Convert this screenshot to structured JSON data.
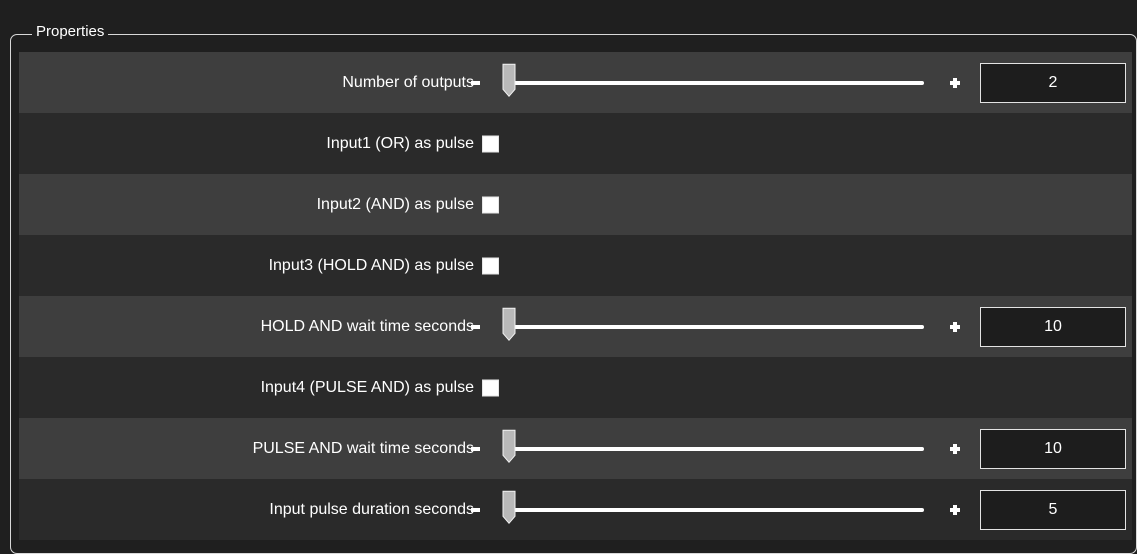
{
  "panel": {
    "title": "Properties"
  },
  "properties": [
    {
      "label": "Number of outputs",
      "type": "slider",
      "value": "2",
      "slider_fraction": 0.0
    },
    {
      "label": "Input1 (OR) as pulse",
      "type": "checkbox",
      "checked": false
    },
    {
      "label": "Input2 (AND) as pulse",
      "type": "checkbox",
      "checked": false
    },
    {
      "label": "Input3 (HOLD AND) as pulse",
      "type": "checkbox",
      "checked": false
    },
    {
      "label": "HOLD AND wait time seconds",
      "type": "slider",
      "value": "10",
      "slider_fraction": 0.0
    },
    {
      "label": "Input4 (PULSE AND) as pulse",
      "type": "checkbox",
      "checked": false
    },
    {
      "label": "PULSE AND wait time seconds",
      "type": "slider",
      "value": "10",
      "slider_fraction": 0.0
    },
    {
      "label": "Input pulse duration seconds",
      "type": "slider",
      "value": "5",
      "slider_fraction": 0.0
    }
  ],
  "colors": {
    "background": "#1f1f1f",
    "row_light": "#3e3e3e",
    "row_dark": "#2a2a2a",
    "text": "#ffffff",
    "thumb_fill": "#b9b9b9"
  },
  "icons": {
    "decrement": "minus-icon",
    "increment": "plus-icon",
    "slider_handle": "slider-thumb-icon",
    "checkbox": "checkbox-icon"
  }
}
